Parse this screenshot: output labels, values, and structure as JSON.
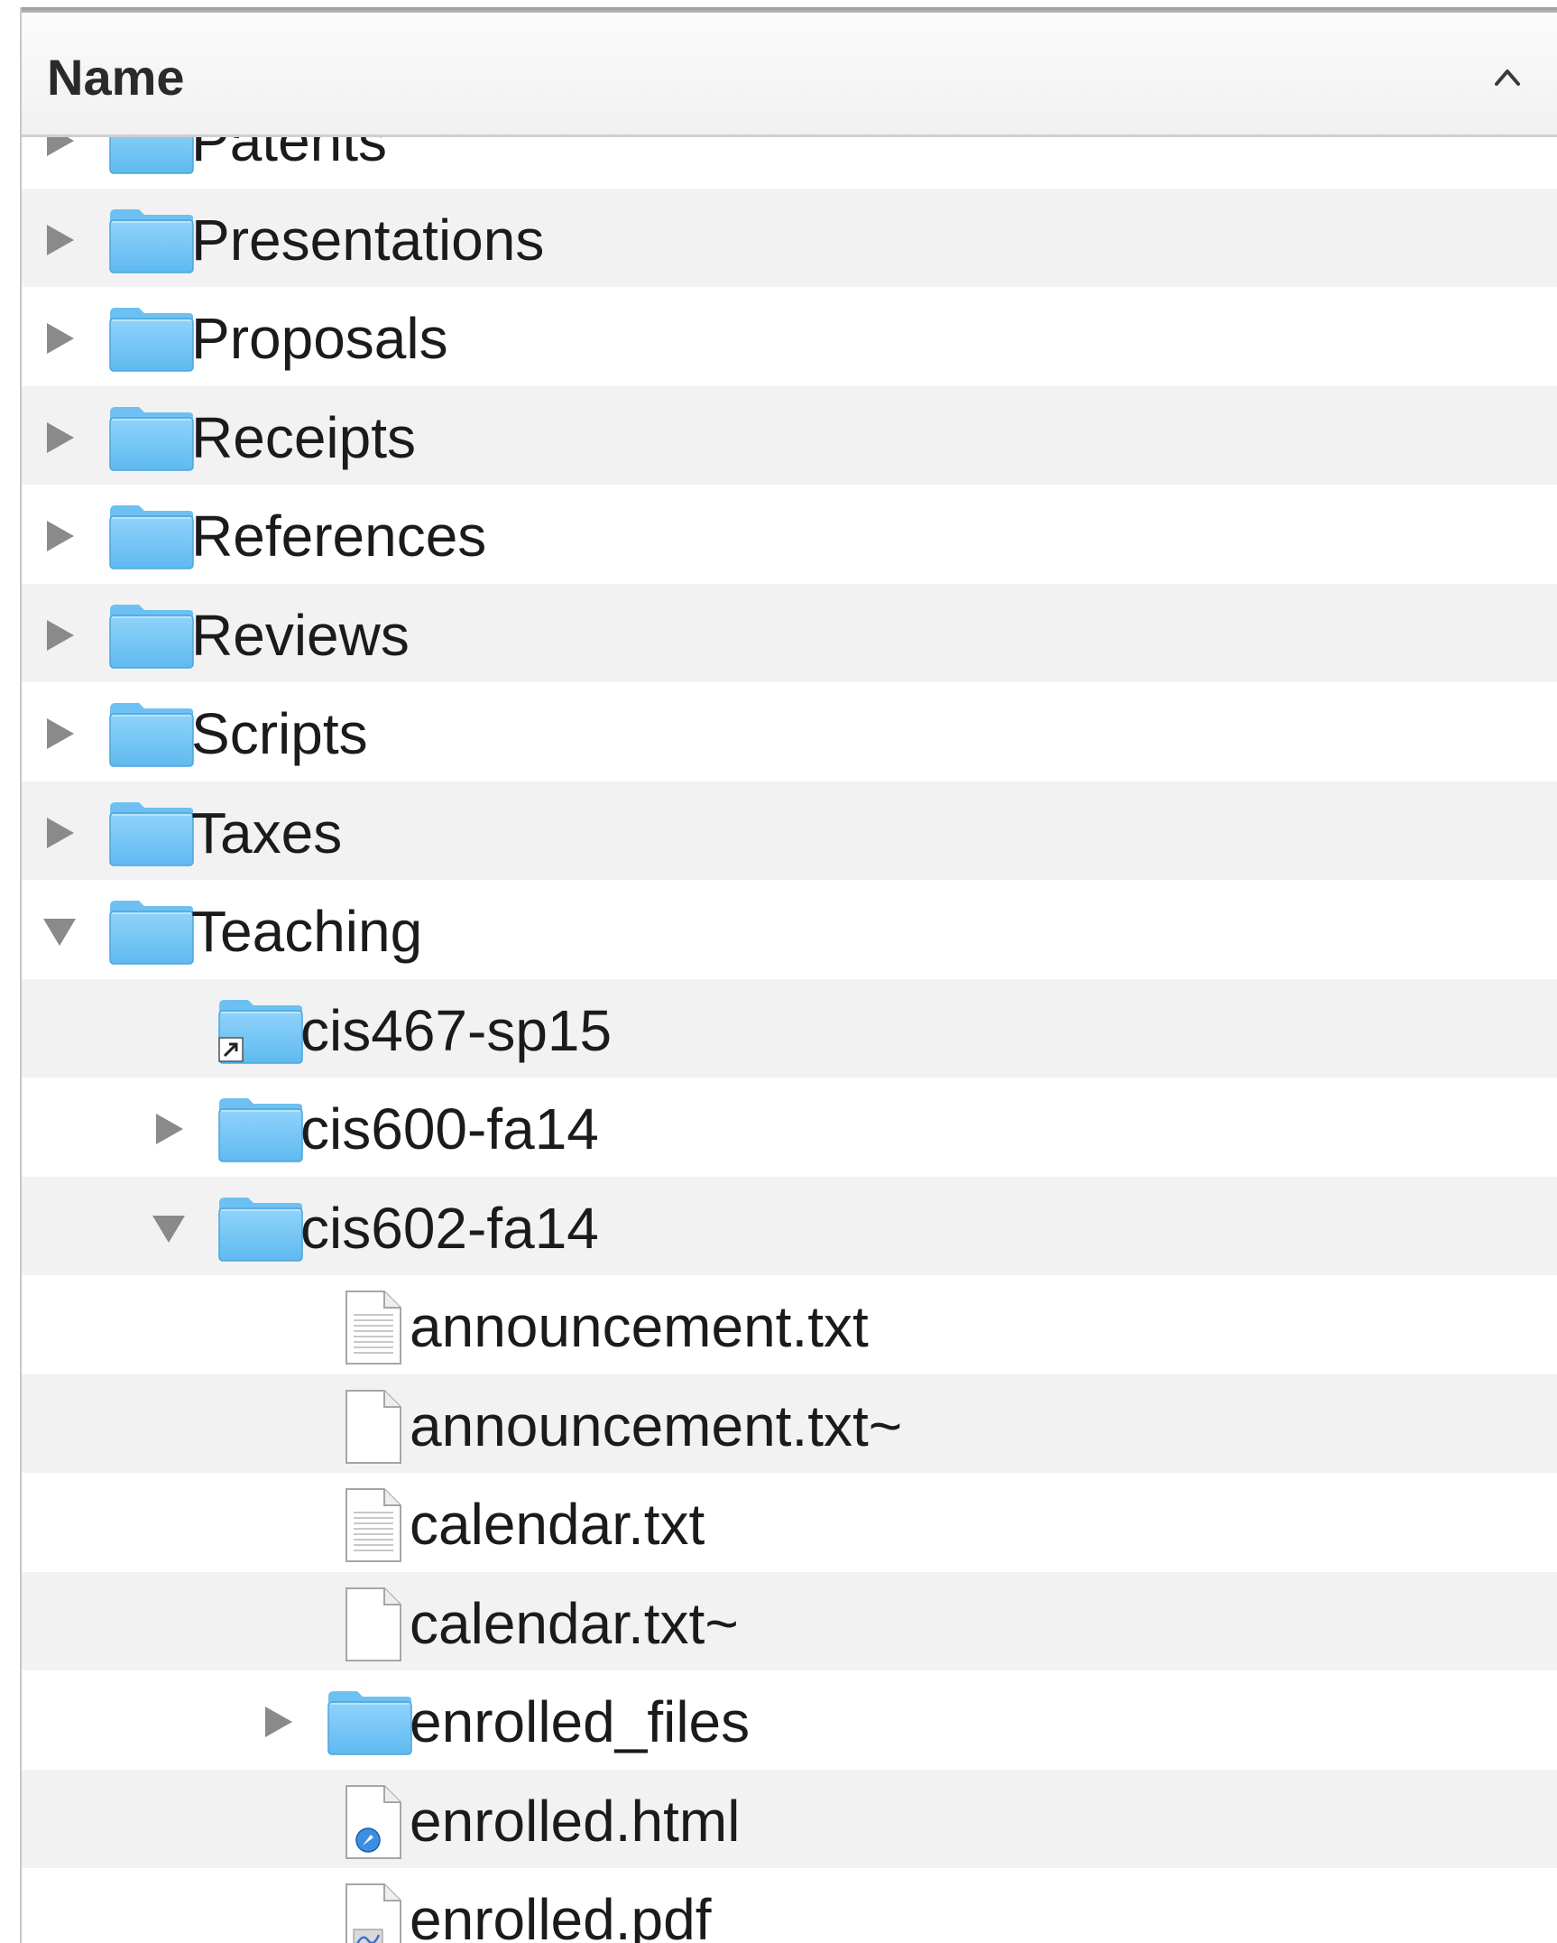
{
  "header": {
    "column_name": "Name",
    "sort_icon": "chevron-up-icon"
  },
  "items": [
    {
      "label": "Patents",
      "kind": "folder",
      "level": 0,
      "disclosure": "collapsed"
    },
    {
      "label": "Presentations",
      "kind": "folder",
      "level": 0,
      "disclosure": "collapsed"
    },
    {
      "label": "Proposals",
      "kind": "folder",
      "level": 0,
      "disclosure": "collapsed"
    },
    {
      "label": "Receipts",
      "kind": "folder",
      "level": 0,
      "disclosure": "collapsed"
    },
    {
      "label": "References",
      "kind": "folder",
      "level": 0,
      "disclosure": "collapsed"
    },
    {
      "label": "Reviews",
      "kind": "folder",
      "level": 0,
      "disclosure": "collapsed"
    },
    {
      "label": "Scripts",
      "kind": "folder",
      "level": 0,
      "disclosure": "collapsed"
    },
    {
      "label": "Taxes",
      "kind": "folder",
      "level": 0,
      "disclosure": "collapsed"
    },
    {
      "label": "Teaching",
      "kind": "folder",
      "level": 0,
      "disclosure": "expanded"
    },
    {
      "label": "cis467-sp15",
      "kind": "folder-alias",
      "level": 1,
      "disclosure": "none"
    },
    {
      "label": "cis600-fa14",
      "kind": "folder",
      "level": 1,
      "disclosure": "collapsed"
    },
    {
      "label": "cis602-fa14",
      "kind": "folder",
      "level": 1,
      "disclosure": "expanded"
    },
    {
      "label": "announcement.txt",
      "kind": "text-file",
      "level": 2,
      "disclosure": "none"
    },
    {
      "label": "announcement.txt~",
      "kind": "blank-file",
      "level": 2,
      "disclosure": "none"
    },
    {
      "label": "calendar.txt",
      "kind": "text-file",
      "level": 2,
      "disclosure": "none"
    },
    {
      "label": "calendar.txt~",
      "kind": "blank-file",
      "level": 2,
      "disclosure": "none"
    },
    {
      "label": "enrolled_files",
      "kind": "folder",
      "level": 2,
      "disclosure": "collapsed"
    },
    {
      "label": "enrolled.html",
      "kind": "html-file",
      "level": 2,
      "disclosure": "none"
    },
    {
      "label": "enrolled.pdf",
      "kind": "pdf-file",
      "level": 2,
      "disclosure": "none"
    }
  ]
}
